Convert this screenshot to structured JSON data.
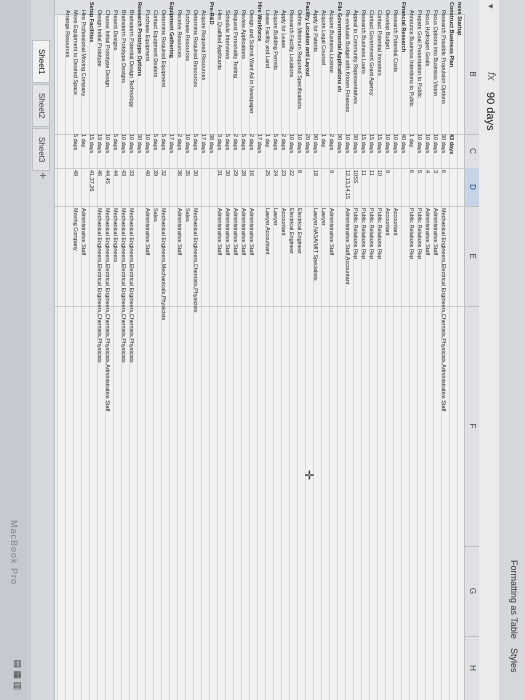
{
  "ribbon": {
    "format_table": "Formatting  as Table",
    "styles": "Styles"
  },
  "formula": {
    "fx": "fx",
    "value": "90 days"
  },
  "columns": [
    "B",
    "C",
    "D",
    "E",
    "F",
    "G",
    "H"
  ],
  "rows": [
    {
      "a": "ness Startup"
    },
    {
      "a": "Construct Business Plan",
      "c": "43 days",
      "bold": true
    },
    {
      "b": "Research Possible Propulsion Options",
      "c": "30 days",
      "d": "6",
      "e": "Mechanical Engineers,Electrical Engineers,Chemists,Physicists,Administrative Staff"
    },
    {
      "b": "Focus Options into Business Vision",
      "c": "10 days",
      "d": "3",
      "e": "Administrative Staff"
    },
    {
      "b": "Focus Hydrogen Goals",
      "c": "10 days",
      "d": "4",
      "e": "Administrative Staff"
    },
    {
      "b": "Prepare Goal Presentation to Public",
      "c": "10 days",
      "d": "5",
      "e": "Public Relations Rep"
    },
    {
      "b": "Announce Business Intentions to Public",
      "c": "1 day",
      "d": "6",
      "e": "Public Relations Rep"
    },
    {
      "a": "Financial Research",
      "c": "40 days"
    },
    {
      "b": "Research Potential Costs",
      "c": "10 days",
      "e": "Accountant"
    },
    {
      "b": "Develop Budget",
      "c": "10 days",
      "d": "9",
      "e": "Accountant"
    },
    {
      "b": "Contact Potential Investors",
      "c": "15 days",
      "d": "10",
      "e": "Public Relations Rep"
    },
    {
      "b": "Contact Government Grant Agency",
      "c": "15 days",
      "d": "11",
      "e": "Public Relations Rep"
    },
    {
      "b": "Research Business Loans",
      "c": "15 days",
      "d": "11",
      "e": "Public Relations Rep"
    },
    {
      "b": "Appeal to Community Representatives",
      "c": "30 days",
      "d": "10SS",
      "e": "Public Relations Rep"
    },
    {
      "b": "Re-evaluate Budget with Known Finances",
      "c": "10 days",
      "d": "12,13,14,15",
      "e": "Administrative Staff,Accountant"
    },
    {
      "a": "File Governmental Applications etc.",
      "c": "90 days"
    },
    {
      "b": "Acquire Business License",
      "c": "2 days",
      "d": "9",
      "e": "Administrative Staff"
    },
    {
      "b": "Acquire Legal Counsel",
      "c": "1 day",
      "e": "Lawyer"
    },
    {
      "b": "Apply for Patents",
      "c": "90 days",
      "d": "18",
      "e": "Lawyer,NASA/MIT Specialists"
    },
    {
      "a": "Facility Location and Layout",
      "c": "20 days"
    },
    {
      "b": "Define Minimum Required Specifications",
      "c": "10 days",
      "d": "8",
      "e": "Electrical Engineer"
    },
    {
      "b": "Research Facility Locations",
      "c": "10 days",
      "d": "22",
      "e": "Electrical Engineer"
    },
    {
      "b": "Apply for Lease",
      "c": "2 days",
      "d": "23",
      "e": "Accountant"
    },
    {
      "b": "Acquire Building Permits",
      "c": "5 days",
      "d": "24",
      "e": "Lawyer"
    },
    {
      "b": "Lease Facility and Land",
      "c": "1 day",
      "d": "25",
      "e": "Lawyer,Accountant"
    },
    {
      "a": "Hire Workforce",
      "c": "17 days"
    },
    {
      "b": "Design and Submit Want Ad in Newspaper",
      "c": "2 days",
      "d": "16",
      "e": "Administrative Staff"
    },
    {
      "b": "Review Applications",
      "c": "5 days",
      "d": "28",
      "e": "Administrative Staff"
    },
    {
      "b": "Request Personality Testing",
      "c": "2 days",
      "d": "29",
      "e": "Administrative Staff"
    },
    {
      "b": "Schedule Interviews",
      "c": "5 days",
      "d": "30",
      "e": "Administrative Staff"
    },
    {
      "b": "Hire Qualified Applicants",
      "c": "3 days",
      "d": "31",
      "e": "Administrative Staff"
    },
    {
      "a": "Pre-R&D",
      "c": "38 days"
    },
    {
      "b": "Acquire Required Resources",
      "c": "17 days"
    },
    {
      "b": "Determine Required Resources",
      "c": "5 days",
      "d": "30",
      "e": "Mechanical Engineers,Chemists,Physicists"
    },
    {
      "b": "Purchase Resources",
      "c": "10 days",
      "d": "35",
      "e": "Sales"
    },
    {
      "b": "Receive Resources",
      "c": "2 days",
      "d": "36",
      "e": "Administrative Staff"
    },
    {
      "a": "Equipment Gathering",
      "c": "17 days"
    },
    {
      "b": "Determine Required Equipment",
      "c": "5 days",
      "d": "32",
      "e": "Mechanical Engineers,Mechanicals,Physicists"
    },
    {
      "b": "Contact Equipment Dealers",
      "c": "5 days",
      "d": "39",
      "e": "Sales"
    },
    {
      "b": "Purchase Equipment",
      "c": "10 days",
      "d": "40",
      "e": "Administrative Staff"
    },
    {
      "a": "Research Prototype Options",
      "c": "30 days"
    },
    {
      "b": "Brainstorm Potential Design Technology",
      "c": "10 days",
      "d": "33",
      "e": "Mechanical Engineers,Electrical Engineers,Chemists,Physicists"
    },
    {
      "b": "Brainstorm Prototype Designs",
      "c": "10 days",
      "d": "43",
      "e": "Mechanical Engineers,Electrical Engineers,Chemists,Physicists"
    },
    {
      "b": "Present Designs",
      "c": "5 days",
      "d": "44",
      "e": "Mechanical Engineers"
    },
    {
      "b": "Choose Initial Prototype Design",
      "c": "10 days",
      "d": "44,45",
      "e": "Mechanical Engineers,Electrical Engineers,Chemists,Physicists,Administrative Staff"
    },
    {
      "b": "Design Initial Prototype",
      "c": "19 days",
      "d": "46",
      "e": "Mechanical Engineers,Electrical Engineers,Chemists,Physicists"
    },
    {
      "a": "Setup Facilities",
      "c": "15 days",
      "d": "41,37,26"
    },
    {
      "b": "Hire Professional Moving Company",
      "c": "1 day",
      "e": "Administrative Staff"
    },
    {
      "b": "Move Equipment to Desired Space",
      "c": "5 days",
      "d": "49",
      "e": "Moving Company"
    },
    {
      "b": "Arrange Resources",
      "c": "",
      "e": ""
    }
  ],
  "tabs": [
    "Sheet1",
    "Sheet2",
    "Sheet3"
  ],
  "brand": "MacBook Pro"
}
